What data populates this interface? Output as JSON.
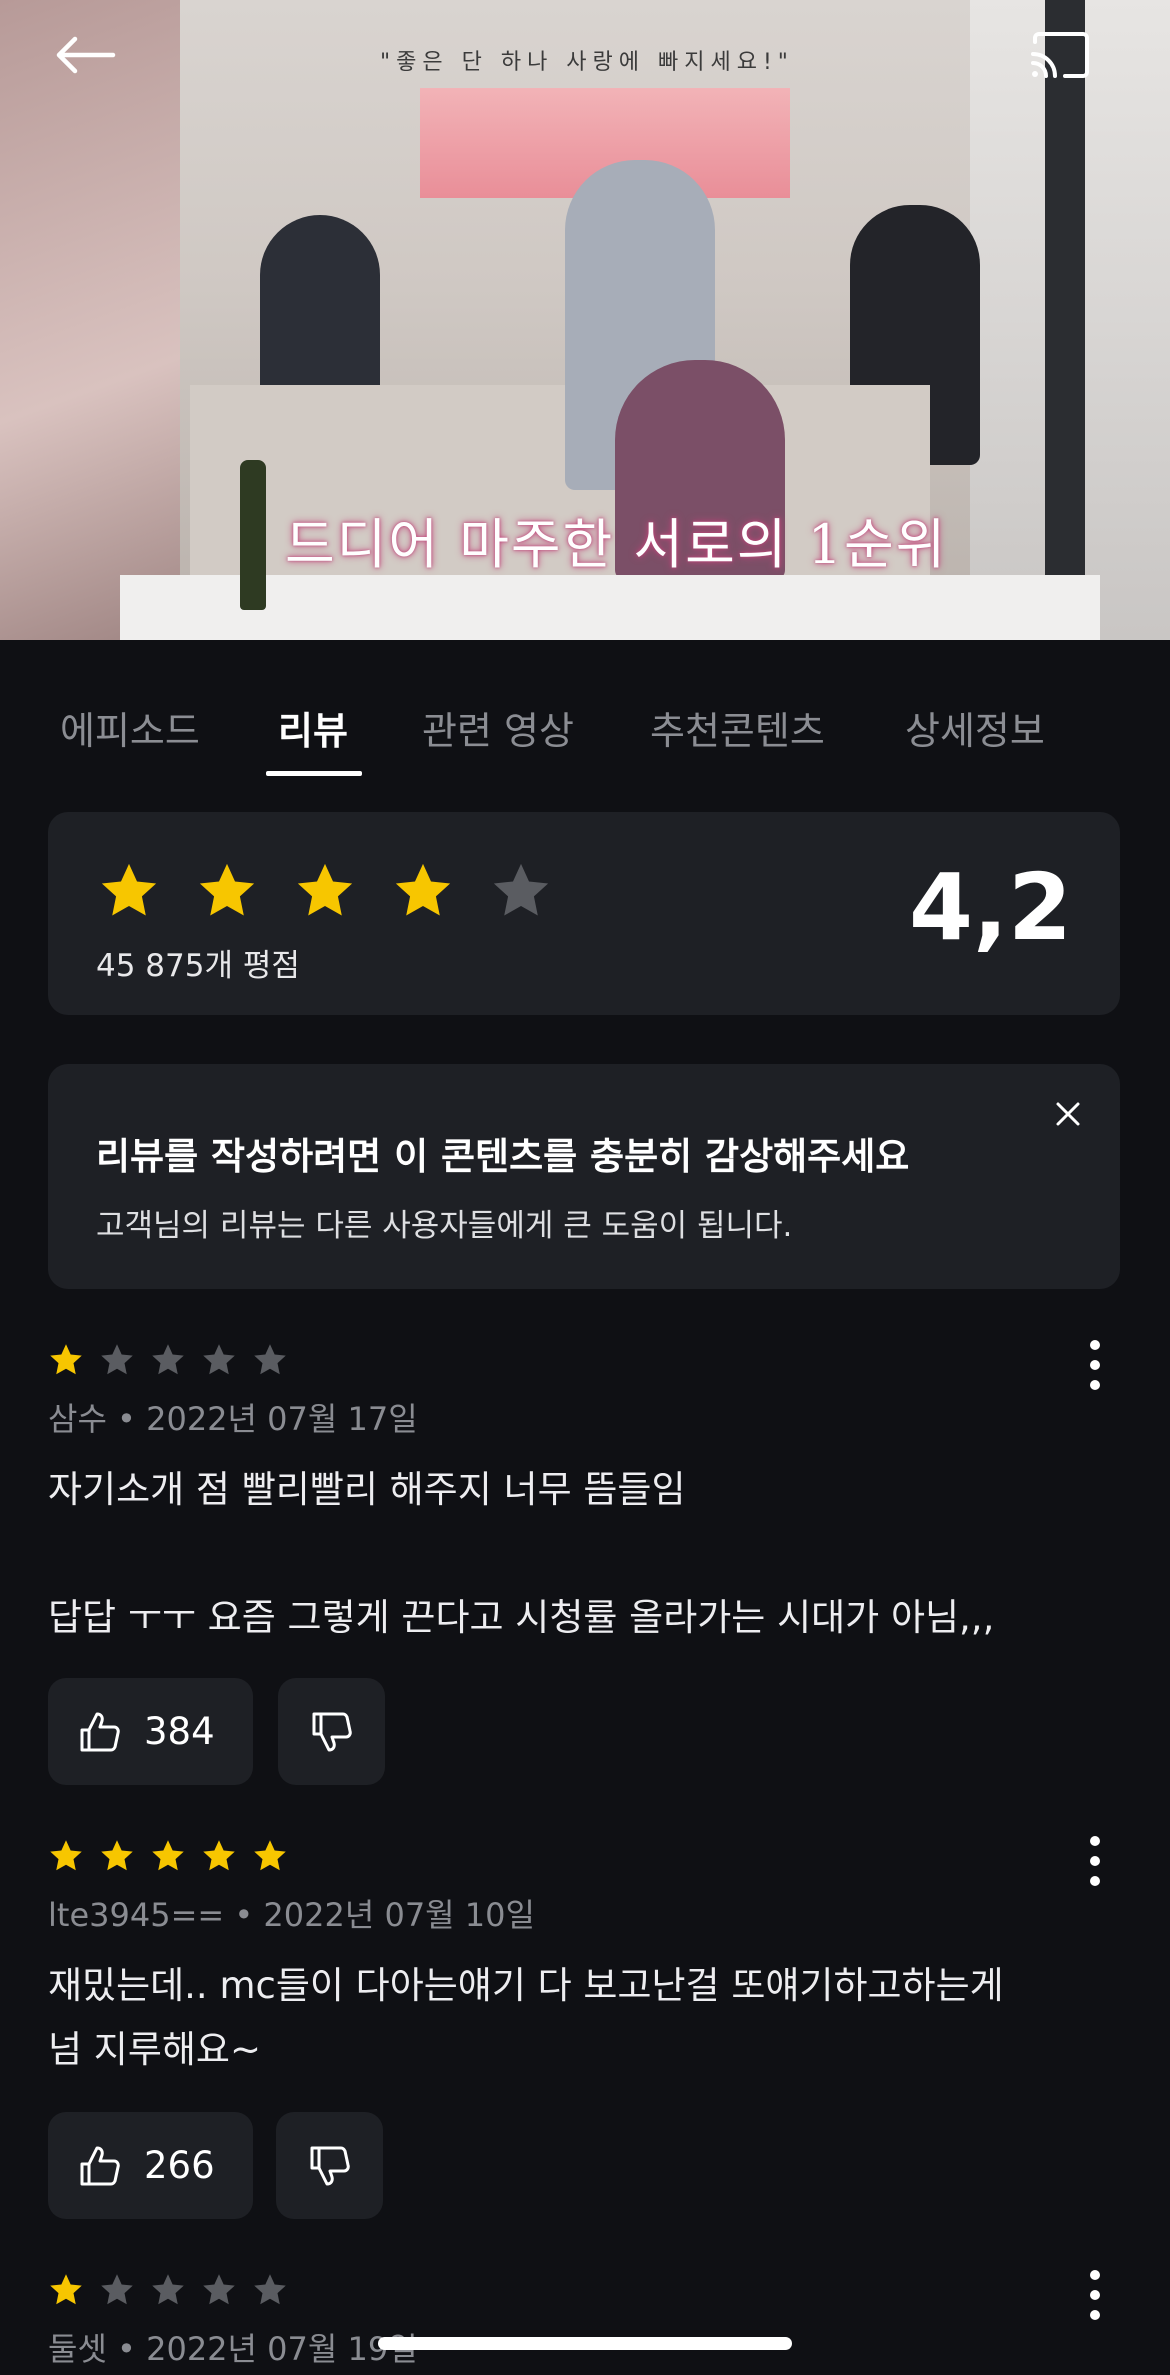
{
  "player": {
    "wall_text": "\"좋은 단 하나 사랑에 빠지세요!\"",
    "subtitle": "드디어 마주한 서로의 1순위"
  },
  "tabs": [
    {
      "label": "에피소드",
      "active": false
    },
    {
      "label": "리뷰",
      "active": true
    },
    {
      "label": "관련 영상",
      "active": false
    },
    {
      "label": "추천콘텐츠",
      "active": false
    },
    {
      "label": "상세정보",
      "active": false
    }
  ],
  "rating": {
    "stars_filled": 4,
    "stars_total": 5,
    "count_label": "45 875개 평점",
    "score": "4,2"
  },
  "notice": {
    "title": "리뷰를 작성하려면 이 콘텐츠를 충분히 감상해주세요",
    "subtitle": "고객님의 리뷰는 다른 사용자들에게 큰 도움이 됩니다."
  },
  "reviews": [
    {
      "stars": 1,
      "author": "삼수",
      "date": "2022년 07월 17일",
      "meta": "삼수 • 2022년 07월 17일",
      "text": "자기소개 점 빨리빨리 해주지 너무 뜸들임\n\n답답 ㅜㅜ 요즘 그렇게 끈다고 시청률 올라가는 시대가 아님,,,",
      "likes": "384"
    },
    {
      "stars": 5,
      "author": "lte3945==",
      "date": "2022년 07월 10일",
      "meta": "lte3945== • 2022년 07월 10일",
      "text": "재밌는데.. mc들이 다아는얘기 다 보고난걸 또얘기하고하는게\n넘 지루해요~",
      "likes": "266"
    },
    {
      "stars": 1,
      "author": "둘셋",
      "date": "2022년 07월 19일",
      "meta": "둘셋 • 2022년 07월 19일",
      "text": "",
      "likes": ""
    }
  ],
  "colors": {
    "background": "#0f1014",
    "card": "#1e2025",
    "star_filled": "#f7c600",
    "star_empty": "#5a5c61",
    "text_muted": "#8a8c92"
  },
  "icons": {
    "back": "arrow-left-icon",
    "cast": "cast-icon",
    "close": "close-icon",
    "more": "more-vertical-icon",
    "like": "thumbs-up-icon",
    "dislike": "thumbs-down-icon",
    "star": "star-icon"
  }
}
